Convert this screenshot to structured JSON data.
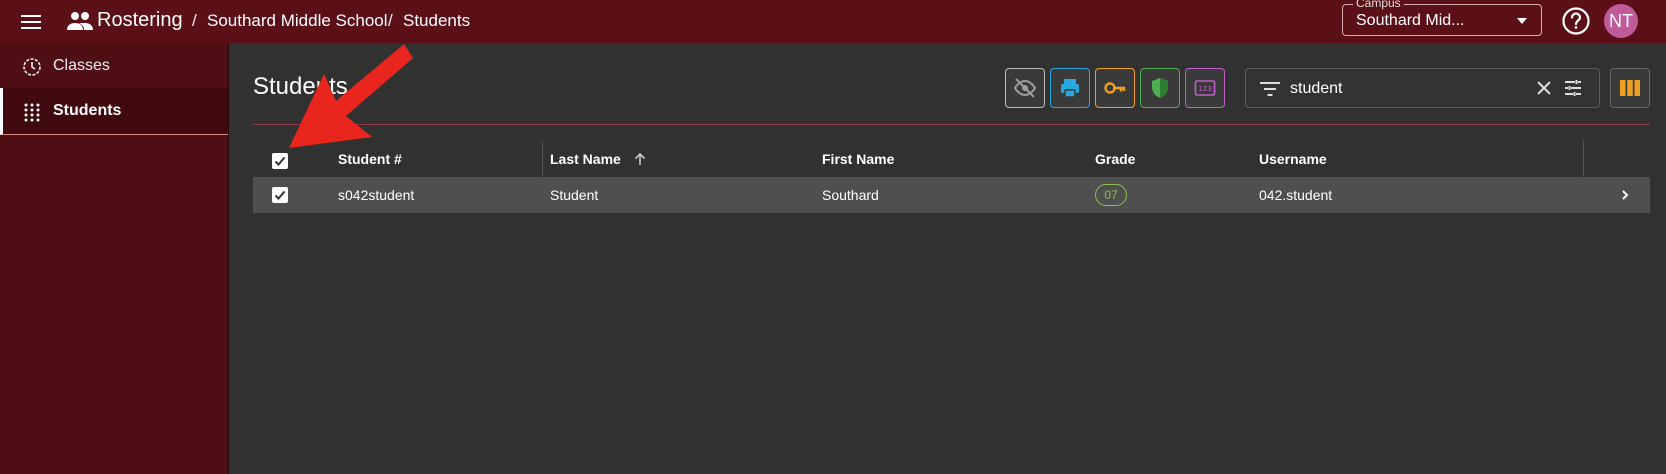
{
  "header": {
    "app_title": "Rostering",
    "breadcrumbs": [
      "Southard Middle School",
      "Students"
    ],
    "separator": "/",
    "campus_label": "Campus",
    "campus_value": "Southard Mid...",
    "avatar_initials": "NT",
    "bar_color": "#5a1016"
  },
  "sidebar": {
    "items": [
      {
        "label": "Classes",
        "icon": "clock-icon",
        "active": false
      },
      {
        "label": "Students",
        "icon": "grid-dots-icon",
        "active": true
      }
    ]
  },
  "main": {
    "title": "Students",
    "toolbar": {
      "buttons": [
        {
          "icon": "eye-off-icon",
          "color": "#9e9e9e"
        },
        {
          "icon": "printer-icon",
          "color": "#29a8e0"
        },
        {
          "icon": "key-icon",
          "color": "#f0a020"
        },
        {
          "icon": "shield-icon",
          "color": "#4caf50"
        },
        {
          "icon": "numeric-123-icon",
          "color": "#c060c8"
        }
      ],
      "filter_value": "student",
      "columns_icon": "view-columns-icon",
      "columns_color": "#f0a020"
    },
    "table": {
      "columns": [
        "Student #",
        "Last Name",
        "First Name",
        "Grade",
        "Username"
      ],
      "sort_column": "Last Name",
      "sort_direction": "ascending",
      "all_selected": true,
      "rows": [
        {
          "selected": true,
          "student_number": "s042student",
          "last_name": "Student",
          "first_name": "Southard",
          "grade": "07",
          "username": "042.student"
        }
      ]
    }
  },
  "annotation": {
    "type": "arrow",
    "color": "#e8261e",
    "points_to": "select-all-checkbox"
  }
}
